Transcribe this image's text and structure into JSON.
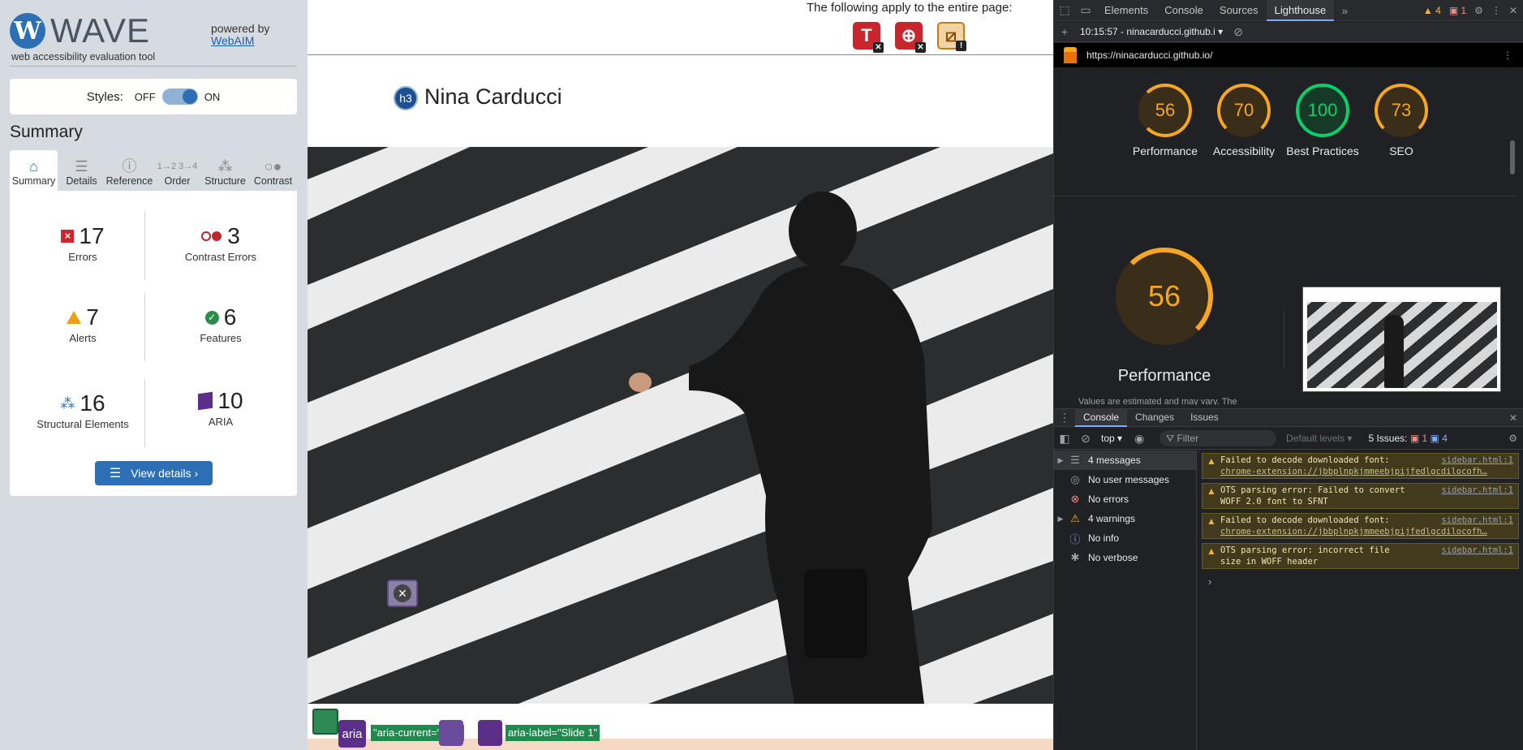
{
  "wave": {
    "logo_letter": "W",
    "logo_text": "WAVE",
    "tagline": "web accessibility evaluation tool",
    "powered_by": "powered by",
    "webaim_link": "WebAIM",
    "styles_label": "Styles:",
    "styles_off": "OFF",
    "styles_on": "ON",
    "summary_heading": "Summary",
    "tabs": [
      {
        "label": "Summary",
        "icon": "home-icon"
      },
      {
        "label": "Details",
        "icon": "list-icon"
      },
      {
        "label": "Reference",
        "icon": "info-icon"
      },
      {
        "label": "Order",
        "icon": "order-icon"
      },
      {
        "label": "Structure",
        "icon": "structure-icon"
      },
      {
        "label": "Contrast",
        "icon": "contrast-icon"
      }
    ],
    "stats": {
      "errors": {
        "value": "17",
        "label": "Errors"
      },
      "contrast_errors": {
        "value": "3",
        "label": "Contrast Errors"
      },
      "alerts": {
        "value": "7",
        "label": "Alerts"
      },
      "features": {
        "value": "6",
        "label": "Features"
      },
      "structural": {
        "value": "16",
        "label": "Structural Elements"
      },
      "aria": {
        "value": "10",
        "label": "ARIA"
      }
    },
    "view_details": "View details ›"
  },
  "page": {
    "notice": "The following apply to the entire page:",
    "h3_badge": "h3",
    "site_name": "Nina Carducci",
    "tag_aria": "aria",
    "tag_aria_current": "\"aria-current=\" true",
    "tag_aria_label": "aria-label=\"Slide 1\""
  },
  "devtools": {
    "tabs": [
      "Elements",
      "Console",
      "Sources",
      "Lighthouse"
    ],
    "active_tab": "Lighthouse",
    "warn_count": "4",
    "err_count": "1",
    "report_select": "10:15:57 - ninacarducci.github.i",
    "url": "https://ninacarducci.github.io/",
    "scores": [
      {
        "value": "56",
        "label": "Performance"
      },
      {
        "value": "70",
        "label": "Accessibility"
      },
      {
        "value": "100",
        "label": "Best Practices"
      },
      {
        "value": "73",
        "label": "SEO"
      }
    ],
    "big_score": "56",
    "big_label": "Performance",
    "note": "Values are estimated and may vary. The",
    "console_tabs": [
      "Console",
      "Changes",
      "Issues"
    ],
    "context": "top",
    "filter_placeholder": "Filter",
    "levels": "Default levels",
    "issues_label": "5 Issues:",
    "issues_err": "1",
    "issues_info": "4",
    "sidebar": [
      {
        "label": "4 messages",
        "icon": "list-icon",
        "arrow": true
      },
      {
        "label": "No user messages",
        "icon": "user-icon",
        "arrow": false
      },
      {
        "label": "No errors",
        "icon": "error-icon",
        "arrow": false
      },
      {
        "label": "4 warnings",
        "icon": "warning-icon",
        "arrow": true
      },
      {
        "label": "No info",
        "icon": "info-icon",
        "arrow": false
      },
      {
        "label": "No verbose",
        "icon": "bug-icon",
        "arrow": false
      }
    ],
    "messages": [
      {
        "line1": "Failed to decode downloaded font:",
        "line2": "chrome-extension://jbbplnpkjmmeebjpijfedlgcdilocofh…",
        "src": "sidebar.html:1"
      },
      {
        "line1": "OTS parsing error: Failed to convert",
        "line2": "WOFF 2.0 font to SFNT",
        "src": "sidebar.html:1"
      },
      {
        "line1": "Failed to decode downloaded font:",
        "line2": "chrome-extension://jbbplnpkjmmeebjpijfedlgcdilocofh…",
        "src": "sidebar.html:1"
      },
      {
        "line1": "OTS parsing error: incorrect file",
        "line2": "size in WOFF header",
        "src": "sidebar.html:1"
      }
    ]
  }
}
